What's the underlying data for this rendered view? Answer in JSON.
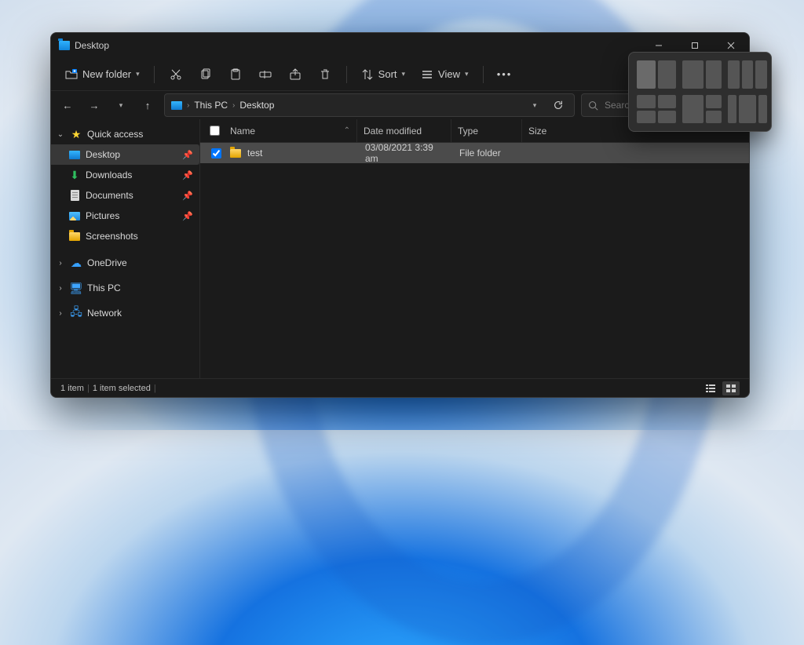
{
  "window": {
    "title": "Desktop"
  },
  "commands": {
    "new_label": "New folder",
    "sort_label": "Sort",
    "view_label": "View"
  },
  "breadcrumb": {
    "0": "This PC",
    "1": "Desktop"
  },
  "search": {
    "placeholder": "Search Desktop"
  },
  "sidebar": {
    "quick_access": "Quick access",
    "desktop": "Desktop",
    "downloads": "Downloads",
    "documents": "Documents",
    "pictures": "Pictures",
    "screenshots": "Screenshots",
    "onedrive": "OneDrive",
    "this_pc": "This PC",
    "network": "Network"
  },
  "columns": {
    "name": "Name",
    "date": "Date modified",
    "type": "Type",
    "size": "Size"
  },
  "rows": [
    {
      "name": "test",
      "date": "03/08/2021 3:39 am",
      "type": "File folder",
      "size": ""
    }
  ],
  "status": {
    "count": "1 item",
    "selected": "1 item selected"
  }
}
